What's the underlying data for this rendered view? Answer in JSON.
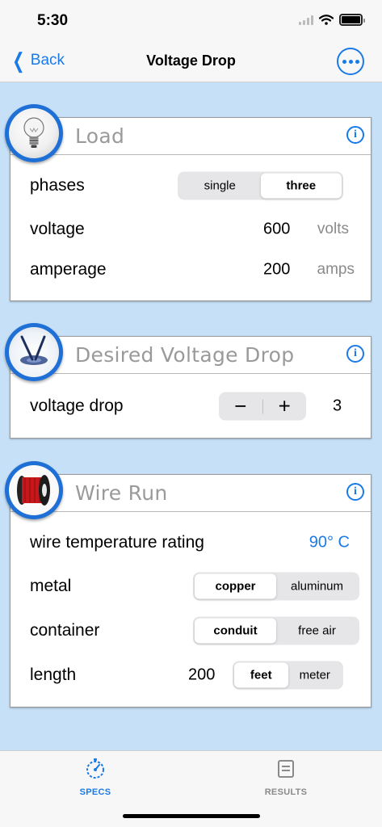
{
  "status": {
    "time": "5:30"
  },
  "nav": {
    "back_label": "Back",
    "title": "Voltage Drop"
  },
  "colors": {
    "accent": "#1a7ae8",
    "background": "#c6e0f7",
    "badge": "#1e6fd6",
    "muted": "#9a9a9a"
  },
  "load": {
    "title": "Load",
    "phases_label": "phases",
    "phases_options": [
      "single",
      "three"
    ],
    "phases_selected": "three",
    "voltage_label": "voltage",
    "voltage_value": "600",
    "voltage_unit": "volts",
    "amperage_label": "amperage",
    "amperage_value": "200",
    "amperage_unit": "amps"
  },
  "desired": {
    "title": "Desired Voltage Drop",
    "drop_label": "voltage drop",
    "minus": "−",
    "plus": "+",
    "drop_value": "3"
  },
  "wire": {
    "title": "Wire Run",
    "temp_label": "wire temperature rating",
    "temp_value": "90° C",
    "metal_label": "metal",
    "metal_options": [
      "copper",
      "aluminum"
    ],
    "metal_selected": "copper",
    "container_label": "container",
    "container_options": [
      "conduit",
      "free air"
    ],
    "container_selected": "conduit",
    "length_label": "length",
    "length_value": "200",
    "length_options": [
      "feet",
      "meter"
    ],
    "length_selected": "feet"
  },
  "tabs": [
    {
      "label": "SPECS",
      "icon": "gauge-icon",
      "active": true
    },
    {
      "label": "RESULTS",
      "icon": "document-icon",
      "active": false
    }
  ],
  "info_glyph": "i"
}
